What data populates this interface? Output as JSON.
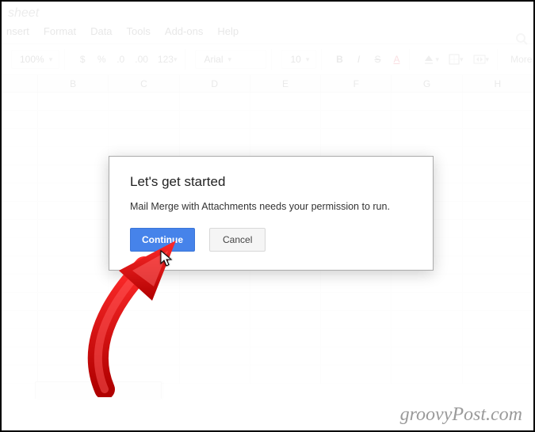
{
  "doc": {
    "title_fragment": "sheet"
  },
  "menu": {
    "items": [
      "nsert",
      "Format",
      "Data",
      "Tools",
      "Add-ons",
      "Help"
    ]
  },
  "toolbar": {
    "zoom": "100%",
    "currency": "$",
    "percent": "%",
    "dec_less": ".0",
    "dec_more": ".00",
    "num_format": "123",
    "font": "Arial",
    "font_size": "10",
    "bold": "B",
    "italic": "I",
    "strike": "S",
    "text_color": "A",
    "more": "More"
  },
  "columns": [
    "B",
    "C",
    "D",
    "E",
    "F",
    "G",
    "H"
  ],
  "dialog": {
    "title": "Let's get started",
    "body": "Mail Merge with Attachments needs your permission to run.",
    "continue": "Continue",
    "cancel": "Cancel"
  },
  "watermark": "groovyPost.com"
}
